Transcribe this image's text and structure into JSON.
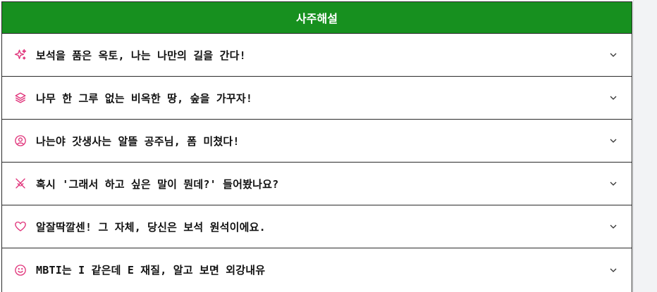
{
  "header": {
    "title": "사주해설"
  },
  "accent_color": "#e0337a",
  "header_color": "#17901f",
  "items": [
    {
      "icon": "sparkles-icon",
      "label": "보석을 품은 옥토, 나는 나만의 길을 간다!"
    },
    {
      "icon": "layers-icon",
      "label": "나무 한 그루 없는 비옥한 땅, 숲을 가꾸자!"
    },
    {
      "icon": "user-circle-icon",
      "label": "나는야 갓생사는 알뜰 공주님, 폼 미쳤다!"
    },
    {
      "icon": "crossed-swords-icon",
      "label": "혹시 '그래서 하고 싶은 말이 뭔데?' 들어봤나요?"
    },
    {
      "icon": "heart-icon",
      "label": "알잘딱깔센! 그 자체, 당신은 보석 원석이에요."
    },
    {
      "icon": "smile-icon",
      "label": "MBTI는 I 같은데 E 재질, 알고 보면 외강내유"
    }
  ]
}
